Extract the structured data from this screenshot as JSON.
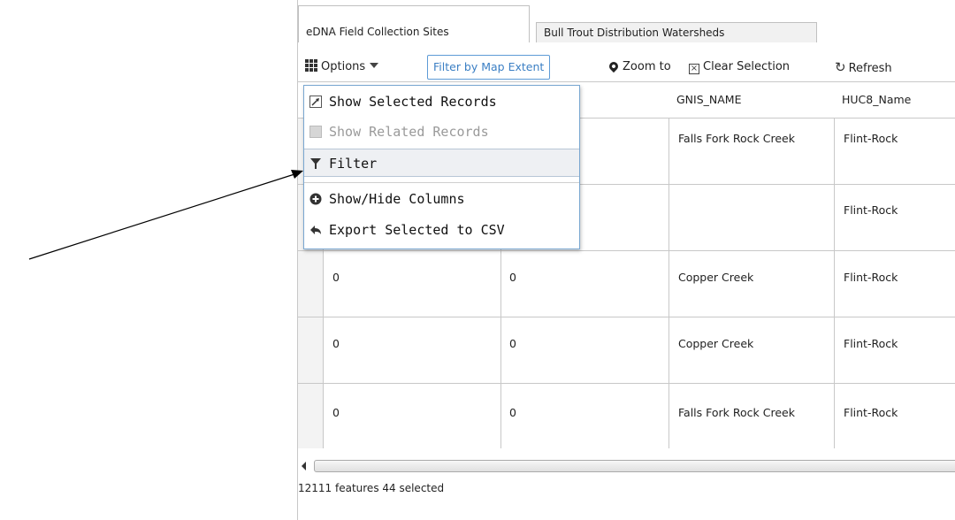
{
  "tabs": [
    "eDNA Field Collection Sites",
    "Bull Trout Distribution Watersheds"
  ],
  "toolbar": {
    "options": "Options",
    "filter_extent": "Filter by Map Extent",
    "zoom": "Zoom to",
    "clear": "Clear Selection",
    "refresh": "Refresh"
  },
  "columns": [
    "",
    "",
    "GNIS_NAME",
    "HUC8_Name"
  ],
  "rows": [
    {
      "c1": "",
      "c2": "",
      "gnis": "Falls Fork Rock Creek",
      "huc": "Flint-Rock"
    },
    {
      "c1": "",
      "c2": "",
      "gnis": "",
      "huc": "Flint-Rock"
    },
    {
      "c1": "0",
      "c2": "0",
      "gnis": "Copper Creek",
      "huc": "Flint-Rock"
    },
    {
      "c1": "0",
      "c2": "0",
      "gnis": "Copper Creek",
      "huc": "Flint-Rock"
    },
    {
      "c1": "0",
      "c2": "0",
      "gnis": "Falls Fork Rock Creek",
      "huc": "Flint-Rock"
    }
  ],
  "footer": "12111 features  44 selected",
  "menu": {
    "show_selected": "Show Selected Records",
    "show_related": "Show Related Records",
    "filter": "Filter",
    "show_hide": "Show/Hide Columns",
    "export": "Export Selected to CSV"
  },
  "icons": [
    "grid-icon",
    "caret-down-icon",
    "pin-icon",
    "clear-box-icon",
    "refresh-icon",
    "zoom-selected-icon",
    "related-icon",
    "funnel-icon",
    "plus-circle-icon",
    "export-arrow-icon",
    "scroll-left-icon"
  ],
  "colors": {
    "accent": "#3b7fc4",
    "border": "#c8c8c8",
    "menu_border": "#7aa7d1"
  }
}
